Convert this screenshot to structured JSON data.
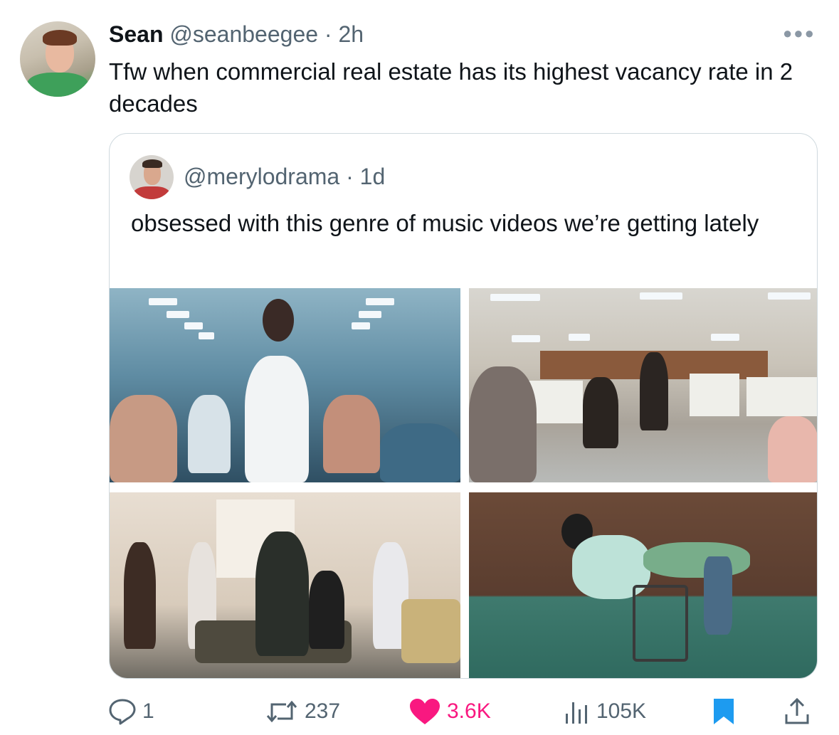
{
  "tweet": {
    "author_name": "Sean",
    "handle_time": "@seanbeegee · 2h",
    "more_icon": "more-horizontal-icon",
    "text": "Tfw when commercial real estate has its highest vacancy rate in 2 decades"
  },
  "quote": {
    "handle_time": "@merylodrama · 1d",
    "text": "obsessed with this genre of music videos we’re getting lately",
    "media_count": 4
  },
  "actions": {
    "replies": "1",
    "retweets": "237",
    "likes": "3.6K",
    "views": "105K",
    "icons": [
      "reply-icon",
      "retweet-icon",
      "heart-icon",
      "views-icon",
      "bookmark-icon",
      "share-icon"
    ]
  },
  "colors": {
    "text": "#0f1419",
    "secondary": "#536471",
    "like": "#f91880",
    "bookmark": "#1d9bf0",
    "border": "#cfd9de"
  }
}
